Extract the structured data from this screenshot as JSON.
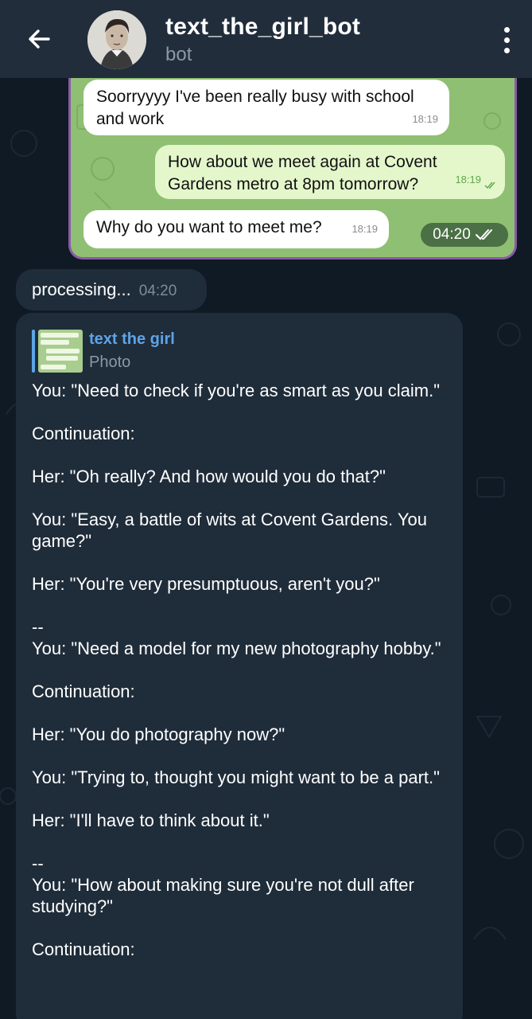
{
  "header": {
    "title": "text_the_girl_bot",
    "subtitle": "bot",
    "back_icon": "arrow-left-icon",
    "menu_icon": "more-vertical-icon"
  },
  "photo": {
    "messages": [
      {
        "text": "Soorryyyy I've been really busy with school and work",
        "time": "18:19",
        "direction": "in"
      },
      {
        "text": "How about we meet again at Covent Gardens metro at 8pm tomorrow?",
        "time": "18:19",
        "direction": "out"
      },
      {
        "text": "Why do you want to meet me?",
        "time": "18:19",
        "direction": "in"
      }
    ],
    "badge_time": "04:20",
    "border_color": "#8a5aa8",
    "bg_color": "#8fbf72"
  },
  "processing": {
    "text": "processing...",
    "time": "04:20"
  },
  "message": {
    "reply_name": "text the girl",
    "reply_sub": "Photo",
    "lines": [
      "You: \"Need to check if you're as smart as you claim.\"",
      "",
      "Continuation:",
      "",
      "Her: \"Oh really? And how would you do that?\"",
      "",
      "You: \"Easy, a battle of wits at Covent Gardens. You game?\"",
      "",
      "Her: \"You're very presumptuous, aren't you?\"",
      "",
      "--",
      "You: \"Need a model for my new photography hobby.\"",
      "",
      "Continuation:",
      "",
      "Her: \"You do photography now?\"",
      "",
      "You: \"Trying to, thought you might want to be a part.\"",
      "",
      "Her: \"I'll have to think about it.\"",
      "",
      "--",
      "You: \"How about making sure you're not dull after studying?\"",
      "",
      "Continuation:"
    ]
  },
  "colors": {
    "header_bg": "#212d3b",
    "chat_bg": "#0f1a24",
    "bubble_bg": "#1f2c3a",
    "accent": "#5ea4e6"
  }
}
